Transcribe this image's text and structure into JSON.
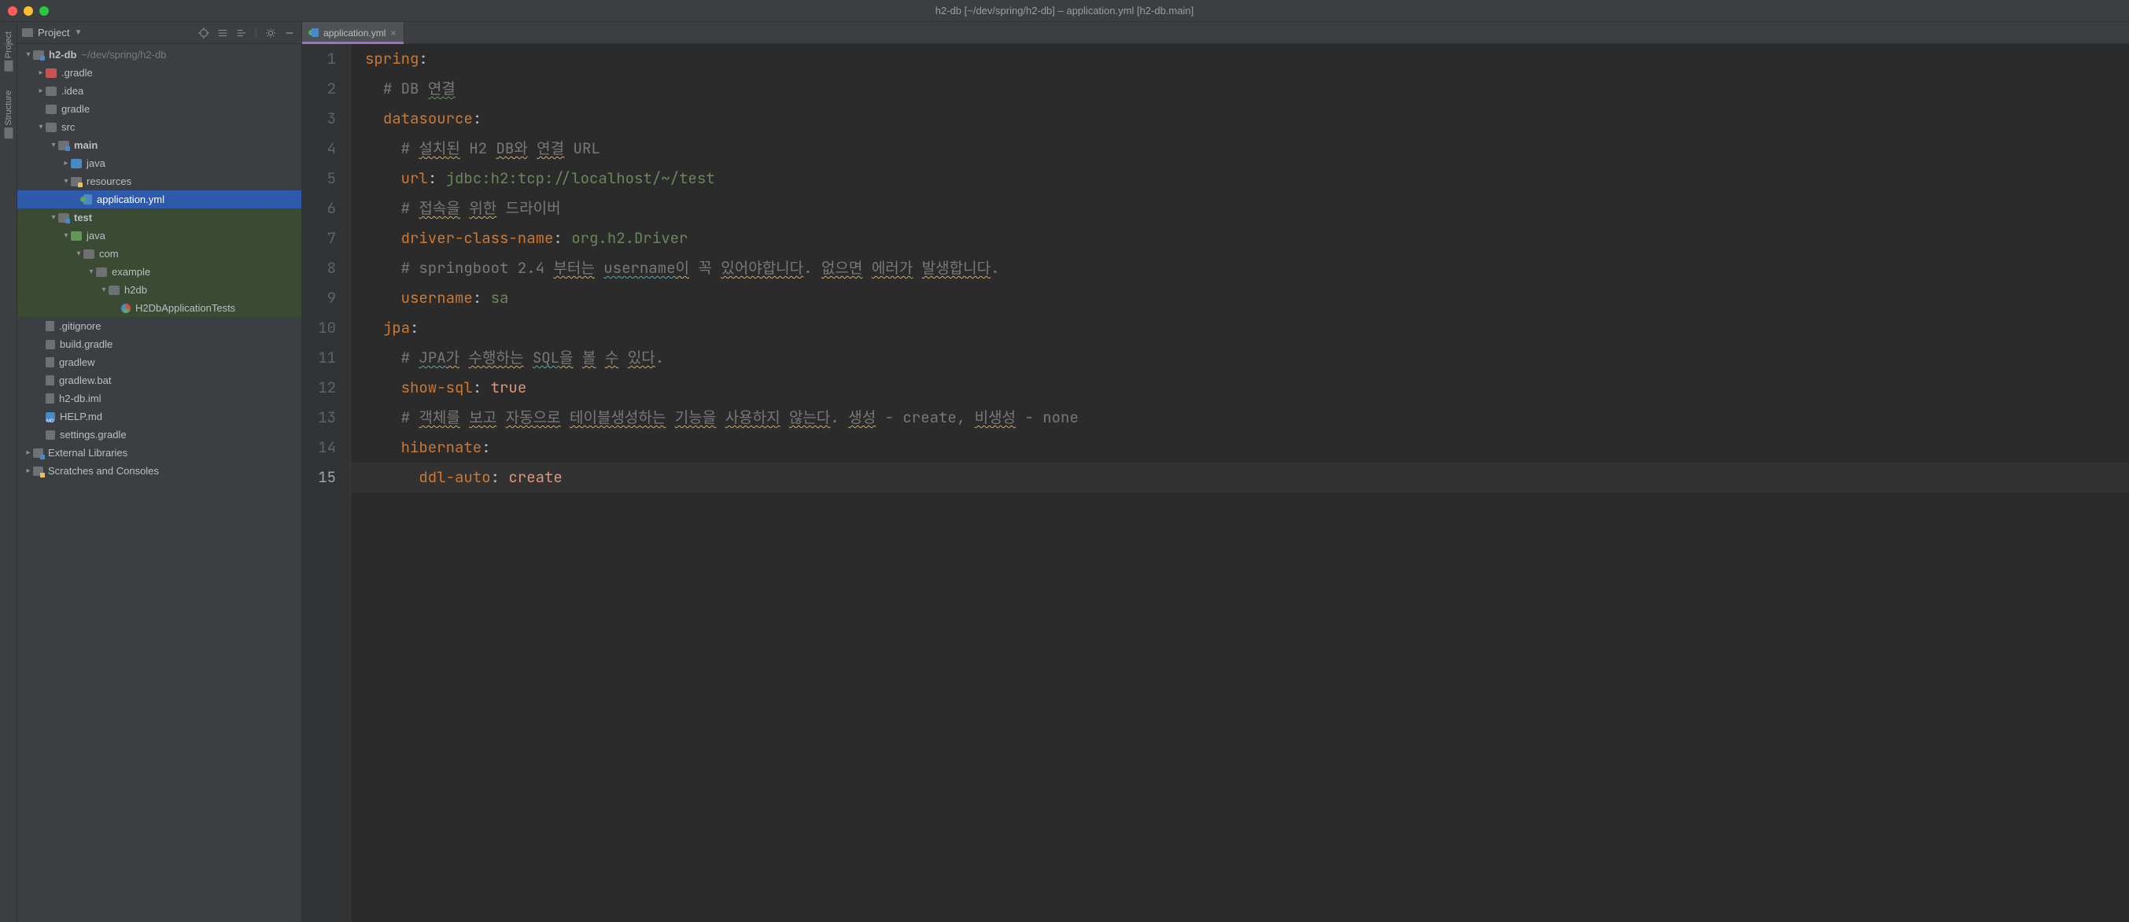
{
  "window": {
    "title": "h2-db [~/dev/spring/h2-db] – application.yml [h2-db.main]"
  },
  "toolstrip": {
    "items": [
      "Project",
      "Structure"
    ]
  },
  "project_toolwindow": {
    "title": "Project",
    "actions": [
      "locate",
      "expand",
      "collapse",
      "settings",
      "hide"
    ]
  },
  "tree": {
    "root": {
      "name": "h2-db",
      "path": "~/dev/spring/h2-db"
    },
    "nodes": [
      {
        "depth": 0,
        "arrow": "down",
        "icon": "folder-mod",
        "label": "h2-db",
        "suffix": "~/dev/spring/h2-db",
        "bold": true
      },
      {
        "depth": 1,
        "arrow": "right",
        "icon": "folder-red",
        "label": ".gradle"
      },
      {
        "depth": 1,
        "arrow": "right",
        "icon": "folder-grey",
        "label": ".idea"
      },
      {
        "depth": 1,
        "arrow": "none",
        "icon": "folder-grey",
        "label": "gradle"
      },
      {
        "depth": 1,
        "arrow": "down",
        "icon": "folder-grey",
        "label": "src"
      },
      {
        "depth": 2,
        "arrow": "down",
        "icon": "folder-mod",
        "label": "main",
        "bold": true
      },
      {
        "depth": 3,
        "arrow": "right",
        "icon": "folder-blue",
        "label": "java"
      },
      {
        "depth": 3,
        "arrow": "down",
        "icon": "folder-res",
        "label": "resources"
      },
      {
        "depth": 4,
        "arrow": "none",
        "icon": "file-y",
        "label": "application.yml",
        "selected": true
      },
      {
        "depth": 2,
        "arrow": "down",
        "icon": "folder-mod",
        "label": "test",
        "bold": true,
        "test": true
      },
      {
        "depth": 3,
        "arrow": "down",
        "icon": "folder-green",
        "label": "java",
        "test": true
      },
      {
        "depth": 4,
        "arrow": "down",
        "icon": "folder-grey",
        "label": "com",
        "test": true
      },
      {
        "depth": 5,
        "arrow": "down",
        "icon": "folder-grey",
        "label": "example",
        "test": true
      },
      {
        "depth": 6,
        "arrow": "down",
        "icon": "folder-grey",
        "label": "h2db",
        "test": true
      },
      {
        "depth": 7,
        "arrow": "none",
        "icon": "circle-tg",
        "label": "H2DbApplicationTests",
        "test": true
      },
      {
        "depth": 1,
        "arrow": "none",
        "icon": "file",
        "label": ".gitignore"
      },
      {
        "depth": 1,
        "arrow": "none",
        "icon": "elephant",
        "label": "build.gradle"
      },
      {
        "depth": 1,
        "arrow": "none",
        "icon": "file",
        "label": "gradlew"
      },
      {
        "depth": 1,
        "arrow": "none",
        "icon": "file",
        "label": "gradlew.bat"
      },
      {
        "depth": 1,
        "arrow": "none",
        "icon": "file",
        "label": "h2-db.iml"
      },
      {
        "depth": 1,
        "arrow": "none",
        "icon": "md",
        "label": "HELP.md"
      },
      {
        "depth": 1,
        "arrow": "none",
        "icon": "elephant",
        "label": "settings.gradle"
      },
      {
        "depth": 0,
        "arrow": "right",
        "icon": "lib",
        "label": "External Libraries"
      },
      {
        "depth": 0,
        "arrow": "right",
        "icon": "scratch",
        "label": "Scratches and Consoles"
      }
    ]
  },
  "editor": {
    "tabs": [
      {
        "label": "application.yml",
        "active": true
      }
    ],
    "current_line": 15,
    "lines": [
      {
        "n": 1,
        "tokens": [
          [
            "k",
            "spring"
          ],
          [
            "p",
            ":"
          ]
        ]
      },
      {
        "n": 2,
        "tokens": [
          [
            "indent",
            1
          ],
          [
            "c",
            "# DB "
          ],
          [
            "c wavy-g",
            "연결"
          ]
        ]
      },
      {
        "n": 3,
        "tokens": [
          [
            "indent",
            1
          ],
          [
            "k",
            "datasource"
          ],
          [
            "p",
            ":"
          ]
        ]
      },
      {
        "n": 4,
        "tokens": [
          [
            "indent",
            2
          ],
          [
            "c",
            "# "
          ],
          [
            "c wavy-y",
            "설치된"
          ],
          [
            "c",
            " H2 "
          ],
          [
            "c wavy-y",
            "DB와"
          ],
          [
            "c",
            " "
          ],
          [
            "c wavy-y",
            "연결"
          ],
          [
            "c",
            " URL"
          ]
        ]
      },
      {
        "n": 5,
        "tokens": [
          [
            "indent",
            2
          ],
          [
            "k",
            "url"
          ],
          [
            "p",
            ": "
          ],
          [
            "s",
            "jdbc:h2:tcp://localhost/~/test"
          ]
        ]
      },
      {
        "n": 6,
        "tokens": [
          [
            "indent",
            2
          ],
          [
            "c",
            "# "
          ],
          [
            "c wavy-y",
            "접속을"
          ],
          [
            "c",
            " "
          ],
          [
            "c wavy-y",
            "위한"
          ],
          [
            "c",
            " "
          ],
          [
            "c",
            "드라이버"
          ]
        ]
      },
      {
        "n": 7,
        "tokens": [
          [
            "indent",
            2
          ],
          [
            "k",
            "driver-class-name"
          ],
          [
            "p",
            ": "
          ],
          [
            "s",
            "org.h2.Driver"
          ]
        ]
      },
      {
        "n": 8,
        "tokens": [
          [
            "indent",
            2
          ],
          [
            "c",
            "# springboot 2.4 "
          ],
          [
            "c wavy-y",
            "부터는"
          ],
          [
            "c",
            " "
          ],
          [
            "c wavy-t",
            "username"
          ],
          [
            "c wavy-y",
            "이"
          ],
          [
            "c",
            " 꼭 "
          ],
          [
            "c wavy-y",
            "있어야합니다"
          ],
          [
            "c",
            ". "
          ],
          [
            "c wavy-y",
            "없으면"
          ],
          [
            "c",
            " "
          ],
          [
            "c wavy-y",
            "에러가"
          ],
          [
            "c",
            " "
          ],
          [
            "c wavy-y",
            "발생합니다"
          ],
          [
            "c",
            "."
          ]
        ]
      },
      {
        "n": 9,
        "tokens": [
          [
            "indent",
            2
          ],
          [
            "k",
            "username"
          ],
          [
            "p",
            ": "
          ],
          [
            "s",
            "sa"
          ]
        ]
      },
      {
        "n": 10,
        "tokens": [
          [
            "indent",
            1
          ],
          [
            "k",
            "jpa"
          ],
          [
            "p",
            ":"
          ]
        ]
      },
      {
        "n": 11,
        "tokens": [
          [
            "indent",
            2
          ],
          [
            "c",
            "# "
          ],
          [
            "c wavy-t",
            "JPA"
          ],
          [
            "c wavy-y",
            "가"
          ],
          [
            "c",
            " "
          ],
          [
            "c wavy-y",
            "수행하는"
          ],
          [
            "c",
            " "
          ],
          [
            "c wavy-t",
            "SQL"
          ],
          [
            "c wavy-y",
            "을"
          ],
          [
            "c",
            " "
          ],
          [
            "c wavy-y",
            "볼"
          ],
          [
            "c",
            " "
          ],
          [
            "c wavy-y",
            "수"
          ],
          [
            "c",
            " "
          ],
          [
            "c wavy-y",
            "있다"
          ],
          [
            "c",
            "."
          ]
        ]
      },
      {
        "n": 12,
        "tokens": [
          [
            "indent",
            2
          ],
          [
            "k",
            "show-sql"
          ],
          [
            "p",
            ": "
          ],
          [
            "v",
            "true"
          ]
        ]
      },
      {
        "n": 13,
        "tokens": [
          [
            "indent",
            2
          ],
          [
            "c",
            "# "
          ],
          [
            "c wavy-y",
            "객체를"
          ],
          [
            "c",
            " "
          ],
          [
            "c wavy-y",
            "보고"
          ],
          [
            "c",
            " "
          ],
          [
            "c wavy-y",
            "자동으로"
          ],
          [
            "c",
            " "
          ],
          [
            "c wavy-y",
            "테이블생성하는"
          ],
          [
            "c",
            " "
          ],
          [
            "c wavy-y",
            "기능을"
          ],
          [
            "c",
            " "
          ],
          [
            "c wavy-y",
            "사용하지"
          ],
          [
            "c",
            " "
          ],
          [
            "c wavy-y",
            "않는다"
          ],
          [
            "c",
            ". "
          ],
          [
            "c wavy-y",
            "생성"
          ],
          [
            "c",
            " - create, "
          ],
          [
            "c wavy-y",
            "비생성"
          ],
          [
            "c",
            " - none"
          ]
        ]
      },
      {
        "n": 14,
        "tokens": [
          [
            "indent",
            2
          ],
          [
            "k",
            "hibernate"
          ],
          [
            "p",
            ":"
          ]
        ]
      },
      {
        "n": 15,
        "tokens": [
          [
            "indent",
            3
          ],
          [
            "k",
            "ddl-auto"
          ],
          [
            "p",
            ": "
          ],
          [
            "v",
            "create"
          ]
        ]
      }
    ]
  }
}
